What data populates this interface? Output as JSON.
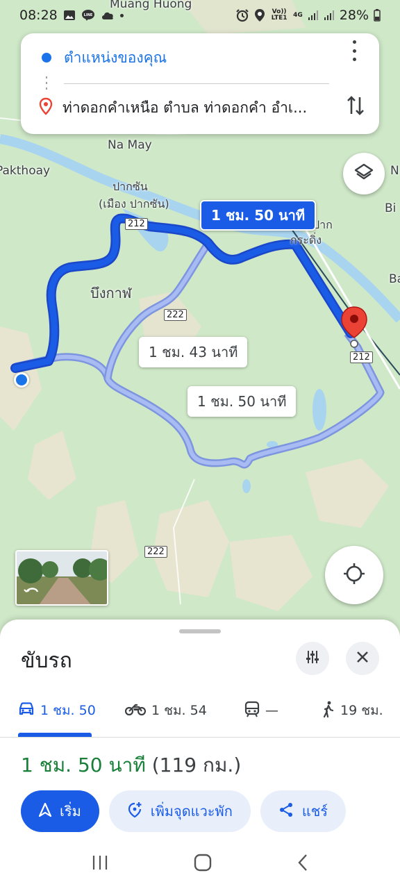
{
  "status_bar": {
    "time": "08:28",
    "volte": "Vo)) LTE1",
    "network": "4G",
    "battery": "28%"
  },
  "search": {
    "origin": "ตำแหน่งของคุณ",
    "destination": "ท่าดอกคำเหนือ ตำบล ท่าดอกคำ อำเ..."
  },
  "map": {
    "labels": {
      "muang_huong": "Muang Huong",
      "na_may": "Na May",
      "pakthoay": "Pakthoay",
      "pak_san": "ปากซัน",
      "muang_pak_san": "(เมือง ปากซัน)",
      "pak": "ปาก",
      "kradeng": "กระดิ่ง",
      "bueng_kan": "บึงกาฬ",
      "right_n": "N",
      "right_bi": "Bi",
      "right_ba": "Ba"
    },
    "road_shields": [
      "212",
      "222",
      "212",
      "222"
    ],
    "routes": {
      "primary": "1 ชม. 50 นาที",
      "alt1": "1 ชม. 43 นาที",
      "alt2": "1 ชม. 50 นาที"
    },
    "colors": {
      "primary_route": "#1a5ce6",
      "alt_route": "#9fb4ee",
      "destination_pin": "#ea4335"
    }
  },
  "sheet": {
    "title": "ขับรถ",
    "modes": {
      "car": "1 ชม. 50",
      "motorbike": "1 ชม. 54",
      "transit": "—",
      "walk": "19 ชม."
    },
    "summary_duration": "1 ชม. 50 นาที",
    "summary_distance": "(119 กม.)",
    "buttons": {
      "start": "เริ่ม",
      "add_stop": "เพิ่มจุดแวะพัก",
      "share": "แชร์"
    }
  }
}
